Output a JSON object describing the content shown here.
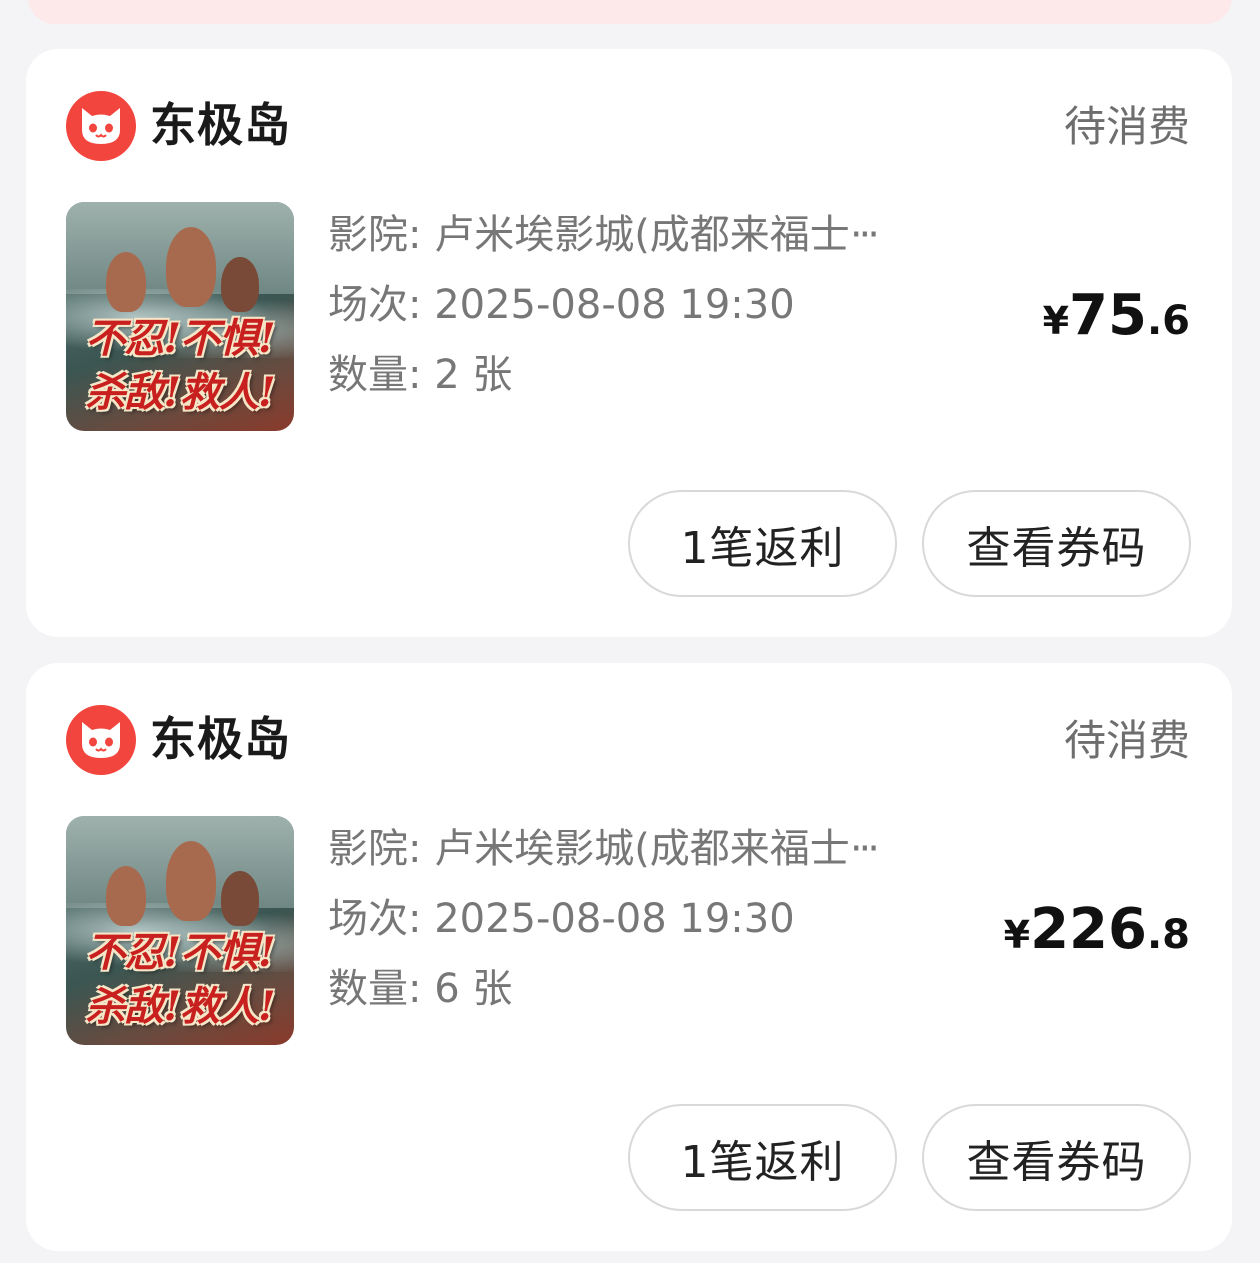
{
  "colors": {
    "brand_red": "#f2453d",
    "status_gray": "#6e6e6e",
    "card_bg": "#ffffff",
    "page_bg": "#f4f4f6"
  },
  "orders": [
    {
      "brand": "东极岛",
      "brand_icon": "cat-logo-icon",
      "status": "待消费",
      "poster_text_line1": "不忍!不惧!",
      "poster_text_line2": "杀敌!救人!",
      "cinema_label": "影院:",
      "cinema_value": "卢米埃影城(成都来福士",
      "cinema_ellipsis": "···",
      "showtime_label": "场次:",
      "showtime_value": "2025-08-08 19:30",
      "quantity_label": "数量:",
      "quantity_value": "2 张",
      "price_currency": "¥",
      "price_integer": "75",
      "price_decimal": ".6",
      "rebate_button": "1笔返利",
      "code_button": "查看券码"
    },
    {
      "brand": "东极岛",
      "brand_icon": "cat-logo-icon",
      "status": "待消费",
      "poster_text_line1": "不忍!不惧!",
      "poster_text_line2": "杀敌!救人!",
      "cinema_label": "影院:",
      "cinema_value": "卢米埃影城(成都来福士",
      "cinema_ellipsis": "···",
      "showtime_label": "场次:",
      "showtime_value": "2025-08-08 19:30",
      "quantity_label": "数量:",
      "quantity_value": "6 张",
      "price_currency": "¥",
      "price_integer": "226",
      "price_decimal": ".8",
      "rebate_button": "1笔返利",
      "code_button": "查看券码"
    }
  ]
}
